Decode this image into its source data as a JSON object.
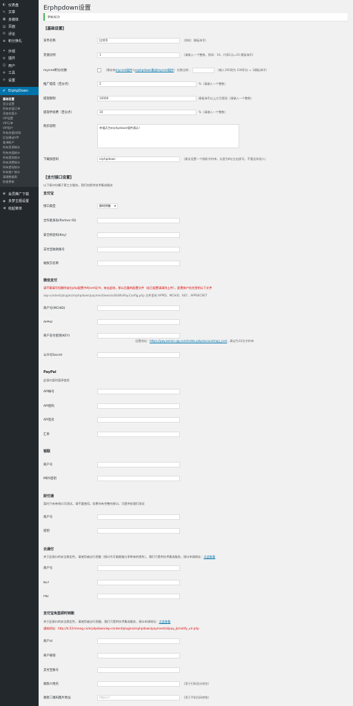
{
  "sidebar": {
    "top_items": [
      {
        "icon": "dashboard-icon",
        "glyph": "◐",
        "label": "仪表盘"
      },
      {
        "icon": "pin-icon",
        "glyph": "✎",
        "label": "文章"
      },
      {
        "icon": "media-icon",
        "glyph": "▣",
        "label": "多媒体"
      },
      {
        "icon": "page-icon",
        "glyph": "▤",
        "label": "页面"
      },
      {
        "icon": "comment-icon",
        "glyph": "✉",
        "label": "评论"
      },
      {
        "icon": "points-icon",
        "glyph": "✚",
        "label": "积分换礼"
      },
      {
        "icon": "appearance-icon",
        "glyph": "✦",
        "label": "外观"
      },
      {
        "icon": "plugin-icon",
        "glyph": "⚙",
        "label": "插件"
      },
      {
        "icon": "users-icon",
        "glyph": "☺",
        "label": "用户"
      },
      {
        "icon": "tools-icon",
        "glyph": "✜",
        "label": "工具"
      },
      {
        "icon": "settings-icon",
        "glyph": "≡",
        "label": "设置"
      }
    ],
    "active": {
      "icon": "erphpdown-icon",
      "glyph": "✐",
      "label": "ErphpDown"
    },
    "sub_items": [
      "基础设置",
      "显示设置",
      "所有充值订单",
      "添加充值卡",
      "VIP设置",
      "VIP订单",
      "VIP用户",
      "所有充值/扣款",
      "后台赠送VIP",
      "查询账户",
      "所有资源统计",
      "所有充值统计",
      "所有提现统计",
      "所有消费统计",
      "所有提现统计",
      "所有推广统计",
      "清理数据表",
      "检查更新"
    ],
    "bottom_items": [
      {
        "icon": "member-icon",
        "glyph": "◉",
        "label": "会员推广下载"
      },
      {
        "icon": "theme-icon",
        "glyph": "◆",
        "label": "多梦主题设置"
      },
      {
        "icon": "collapse-icon",
        "glyph": "◀",
        "label": "收起菜单"
      }
    ]
  },
  "page": {
    "title": "Erphpdown设置",
    "notice": "更新成功！"
  },
  "basic": {
    "title": "【基础设置】",
    "currency_label": "货币名称",
    "currency_value": "比特币",
    "currency_note": "（例如：模板海币）",
    "ratio_label": "充值比例",
    "ratio_value": "1",
    "ratio_note": "（请输入一个整数，例如：10，代表1元=10 模板海币）",
    "mycred_label": "mycred积分兑换",
    "mycred_note_a": "（需安装",
    "mycred_link_a": "mycred插件",
    "mycred_note_b": "与",
    "mycred_link_b": "erphpdown集成mycred插件",
    "mycred_note_c": "）兑换比例：",
    "mycred_note_d": "（输入100则为 100积分 = 1模板海币）",
    "promo_label": "推广提成（百分点）",
    "promo_value": "2",
    "promo_note": "%（请输入一个整数）",
    "withdraw_label": "提现限制",
    "withdraw_value": "10000",
    "withdraw_note": "模板海币以上方可提现（请输入一个整数）",
    "fee_label": "提现手续费（百分点）",
    "fee_value": "10",
    "fee_note": "%（请输入一个整数）",
    "buy_label": "购买说明",
    "buy_value": "幸福天为erphpdown插件演示！",
    "key_label": "下载加密码",
    "key_value": "erphpdown",
    "key_note": "（建议设置一个随机字符串，长度为8位左右即可，不要告知他人）"
  },
  "payment": {
    "title": "【支付接口设置】",
    "desc": "以下接口均属于第三方服务，我们仅提供技术集成服务"
  },
  "alipay": {
    "title": "支付宝",
    "type_label": "接口类型",
    "type_value": "即时到账",
    "partner_label": "合作者身份(Partner ID)",
    "key_label": "安全校验码(Key)",
    "account_label": "支付宝收款账号",
    "name_label": "收款方名称"
  },
  "wechat": {
    "title": "微信支付",
    "warn": "请不要填写但删除该位php配置中的cert证书，来自此地，那以后重的配置文件（若已配置请清除上传），配置商户信任密钥以下文件",
    "path": "/wp-content/plugins/erphpdown/payment/weixin/lib/WxPay.Config.php 文件里的 APPID、MCHID、KEY、APPSECRET",
    "mchid_label": "商户号(MCHID)",
    "appid_label": "APPID",
    "key_label": "商户支付密钥(KEY)",
    "key_note_a": "设置地址：",
    "key_link": "https://pay.weixin.qq.com/index.php/account/api_cert",
    "key_note_b": "，建议为32位字符串",
    "secret_label": "公众号Secret"
  },
  "paypal": {
    "title": "PayPal",
    "desc": "此接口暂时暂停使用",
    "api_user_label": "API帐号",
    "api_pwd_label": "API密码",
    "api_sig_label": "API签名",
    "rate_label": "汇率"
  },
  "chinabank": {
    "title": "银联",
    "merchant_label": "商户号",
    "md5_label": "MD5密钥"
  },
  "caifutong": {
    "title": "财付通",
    "desc": "暂时只有单接口可测试，请不要使用，如果你有完整的接口，可提供给我们测试",
    "merchant_label": "商户号",
    "key_label": "密钥"
  },
  "cloudpay": {
    "title": "云通付",
    "desc_a": "关于此接口的安全稳定性，请使用者自行把握（接口为可能跑路分享带来的损失），我们只提供技术集成服务，接口申请地址：",
    "desc_link": "点此查看",
    "merchant_label": "商户号",
    "key_label": "KEY",
    "pid_label": "PID"
  },
  "alipay_instant": {
    "title": "支付宝免签即时到账",
    "desc_a": "关于此接口的安全稳定性，请使用者自行把握，我们只提供技术集成服务，接口申请地址：",
    "desc_link": "点此查看",
    "notify_a": "通知网址：",
    "notify_url": "http://d.52rimeng.cn/erphpdown/wp-content/plugins/erphpdown/payment/alipay_jk/notify_url.php",
    "pid_label": "商户id",
    "secret_label": "商户秘钥",
    "account_label": "支付宝账号",
    "name_label": "收款人姓名",
    "name_note": "（用于扫码显示姓名）",
    "qr_label": "收款二维码图片地址",
    "qr_placeholder": "https://",
    "qr_note": "（用于手机扫码转账）"
  }
}
